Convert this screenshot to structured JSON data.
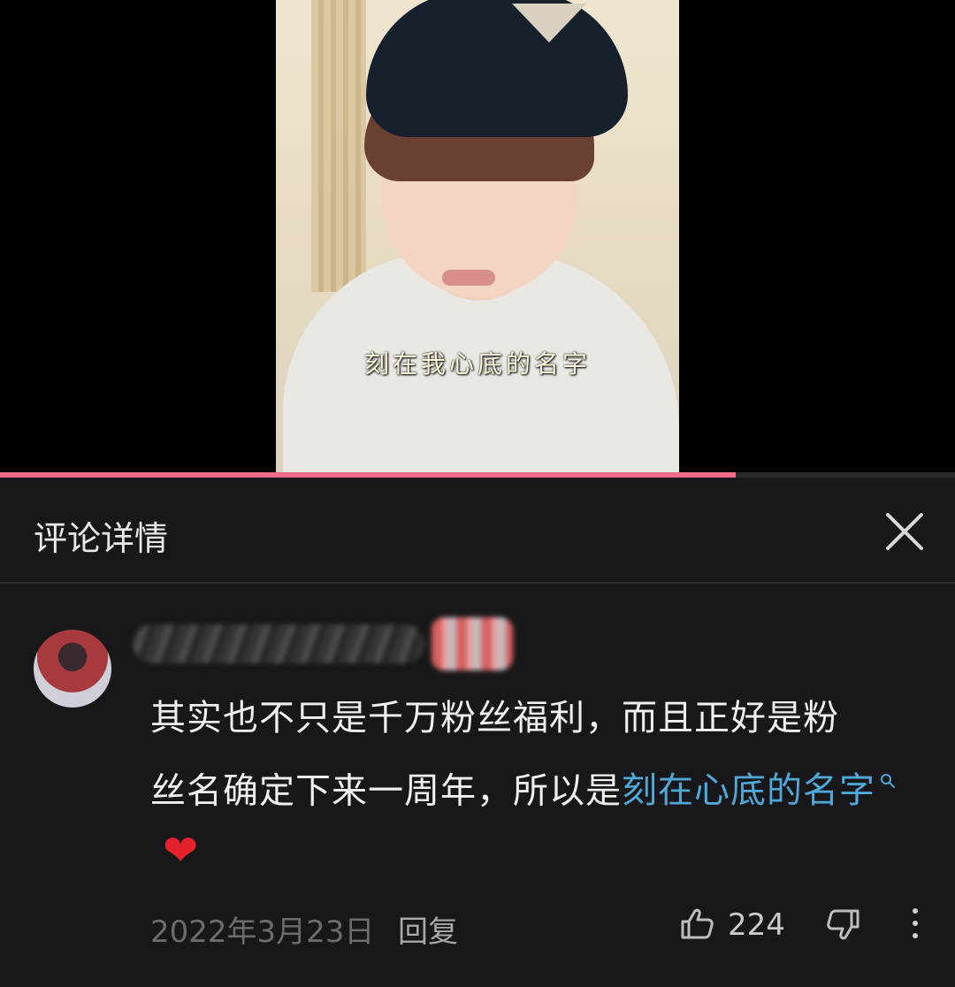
{
  "video": {
    "subtitle": "刻在我心底的名字",
    "progress_fraction": 0.77
  },
  "header": {
    "title": "评论详情"
  },
  "comment": {
    "text_lines": [
      "其实也不只是千万粉丝福利，而且正好是粉",
      "丝名确定下来一周年，所以是"
    ],
    "search_keyword": "刻在心底的名字",
    "date": "2022年3月23日",
    "reply_label": "回复",
    "like_count": "224"
  },
  "icons": {
    "close": "close-icon",
    "search": "search-icon",
    "heart": "heart-icon",
    "like": "thumbs-up-icon",
    "dislike": "thumbs-down-icon",
    "more": "more-vertical-icon"
  },
  "colors": {
    "accent_progress": "#f26b8a",
    "link": "#4fa8d8",
    "heart": "#e4222b"
  }
}
